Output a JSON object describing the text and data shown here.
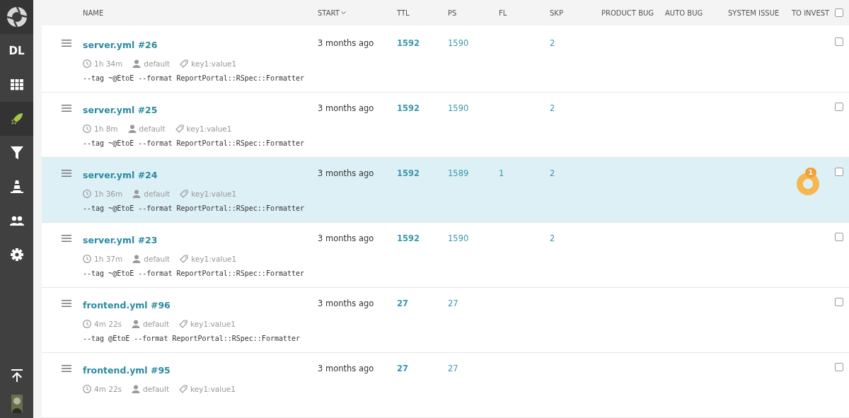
{
  "sidebar": {
    "logo": {
      "kind": "logo"
    },
    "items": [
      {
        "kind": "text",
        "label": "DL",
        "selected": false
      },
      {
        "kind": "grid",
        "selected": false
      },
      {
        "kind": "rocket",
        "selected": true
      },
      {
        "kind": "filter",
        "selected": false
      },
      {
        "kind": "cone",
        "selected": false
      },
      {
        "kind": "people",
        "selected": false
      },
      {
        "kind": "gear",
        "selected": false
      }
    ],
    "bottom": [
      {
        "kind": "upload"
      },
      {
        "kind": "avatar"
      }
    ]
  },
  "table": {
    "columns": [
      {
        "label": "NAME",
        "sort": false
      },
      {
        "label": "START",
        "sort": true
      },
      {
        "label": "TTL",
        "sort": false
      },
      {
        "label": "PS",
        "sort": false
      },
      {
        "label": "FL",
        "sort": false
      },
      {
        "label": "SKP",
        "sort": false
      },
      {
        "label": "PRODUCT BUG",
        "sort": false
      },
      {
        "label": "AUTO BUG",
        "sort": false
      },
      {
        "label": "SYSTEM ISSUE",
        "sort": false
      },
      {
        "label": "TO INVEST",
        "sort": false
      }
    ],
    "select_all": false,
    "rows": [
      {
        "name": "server.yml #26",
        "duration": "1h 34m",
        "owner": "default",
        "attribute": "key1:value1",
        "command": "--tag ~@EtoE --format ReportPortal::RSpec::Formatter",
        "start": "3 months ago",
        "ttl": "1592",
        "ps": "1590",
        "fl": "",
        "skp": "2",
        "to_invest": "",
        "highlighted": false,
        "checked": false
      },
      {
        "name": "server.yml #25",
        "duration": "1h 8m",
        "owner": "default",
        "attribute": "key1:value1",
        "command": "--tag ~@EtoE --format ReportPortal::RSpec::Formatter",
        "start": "3 months ago",
        "ttl": "1592",
        "ps": "1590",
        "fl": "",
        "skp": "2",
        "to_invest": "",
        "highlighted": false,
        "checked": false
      },
      {
        "name": "server.yml #24",
        "duration": "1h 36m",
        "owner": "default",
        "attribute": "key1:value1",
        "command": "--tag ~@EtoE --format ReportPortal::RSpec::Formatter",
        "start": "3 months ago",
        "ttl": "1592",
        "ps": "1589",
        "fl": "1",
        "skp": "2",
        "to_invest": "1",
        "highlighted": true,
        "checked": false
      },
      {
        "name": "server.yml #23",
        "duration": "1h 37m",
        "owner": "default",
        "attribute": "key1:value1",
        "command": "--tag ~@EtoE --format ReportPortal::RSpec::Formatter",
        "start": "3 months ago",
        "ttl": "1592",
        "ps": "1590",
        "fl": "",
        "skp": "2",
        "to_invest": "",
        "highlighted": false,
        "checked": false
      },
      {
        "name": "frontend.yml #96",
        "duration": "4m 22s",
        "owner": "default",
        "attribute": "key1:value1",
        "command": "--tag @EtoE --format ReportPortal::RSpec::Formatter",
        "start": "3 months ago",
        "ttl": "27",
        "ps": "27",
        "fl": "",
        "skp": "",
        "to_invest": "",
        "highlighted": false,
        "checked": false
      },
      {
        "name": "frontend.yml #95",
        "duration": "4m 22s",
        "owner": "default",
        "attribute": "key1:value1",
        "start": "3 months ago",
        "ttl": "27",
        "ps": "27",
        "fl": "",
        "skp": "",
        "to_invest": "",
        "highlighted": false,
        "checked": false
      }
    ]
  }
}
